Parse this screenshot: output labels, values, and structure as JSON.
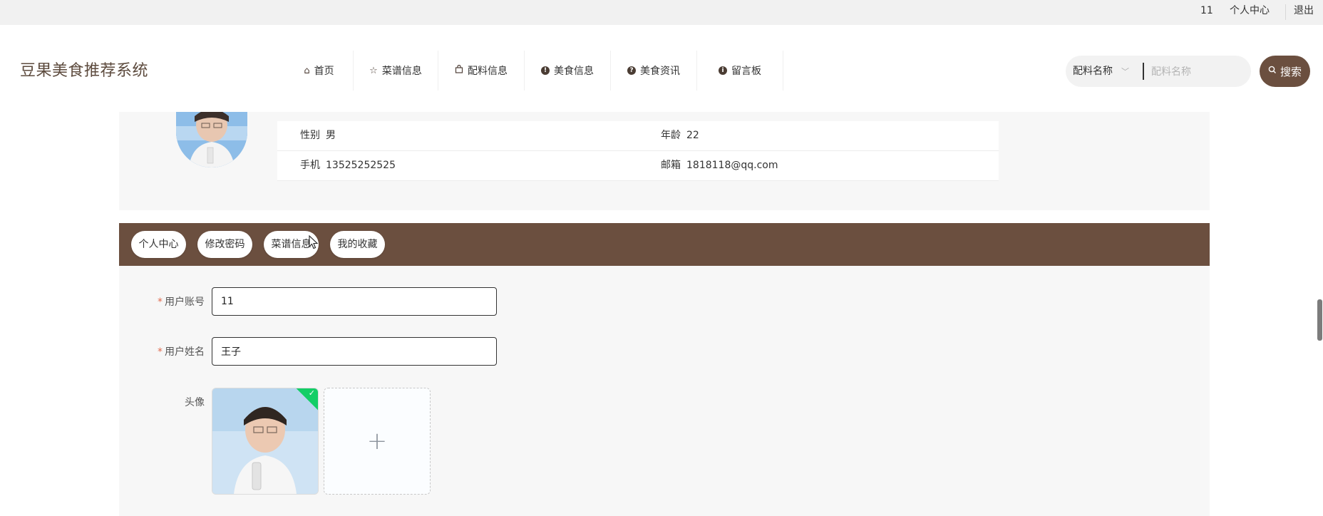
{
  "topbar": {
    "user_id": "11",
    "personal_center": "个人中心",
    "logout": "退出"
  },
  "header": {
    "brand": "豆果美食推荐系统",
    "nav": [
      {
        "label": "首页",
        "icon": "home-icon"
      },
      {
        "label": "菜谱信息",
        "icon": "star-icon"
      },
      {
        "label": "配料信息",
        "icon": "bag-icon"
      },
      {
        "label": "美食信息",
        "icon": "exclamation-circle-icon"
      },
      {
        "label": "美食资讯",
        "icon": "question-circle-icon"
      },
      {
        "label": "留言板",
        "icon": "info-circle-icon"
      }
    ],
    "search": {
      "select_value": "配料名称",
      "placeholder": "配料名称",
      "button_label": "搜索"
    }
  },
  "profile": {
    "gender_label": "性别",
    "gender_value": "男",
    "age_label": "年龄",
    "age_value": "22",
    "phone_label": "手机",
    "phone_value": "13525252525",
    "email_label": "邮箱",
    "email_value": "1818118@qq.com"
  },
  "tabs": [
    "个人中心",
    "修改密码",
    "菜谱信息",
    "我的收藏"
  ],
  "form": {
    "account_label": "用户账号",
    "account_value": "11",
    "name_label": "用户姓名",
    "name_value": "王子",
    "avatar_label": "头像",
    "required_mark": "*",
    "add_symbol": "+"
  },
  "colors": {
    "brand_brown": "#6b4f3f",
    "success_green": "#13ce66",
    "required_red": "#e06b4f"
  }
}
